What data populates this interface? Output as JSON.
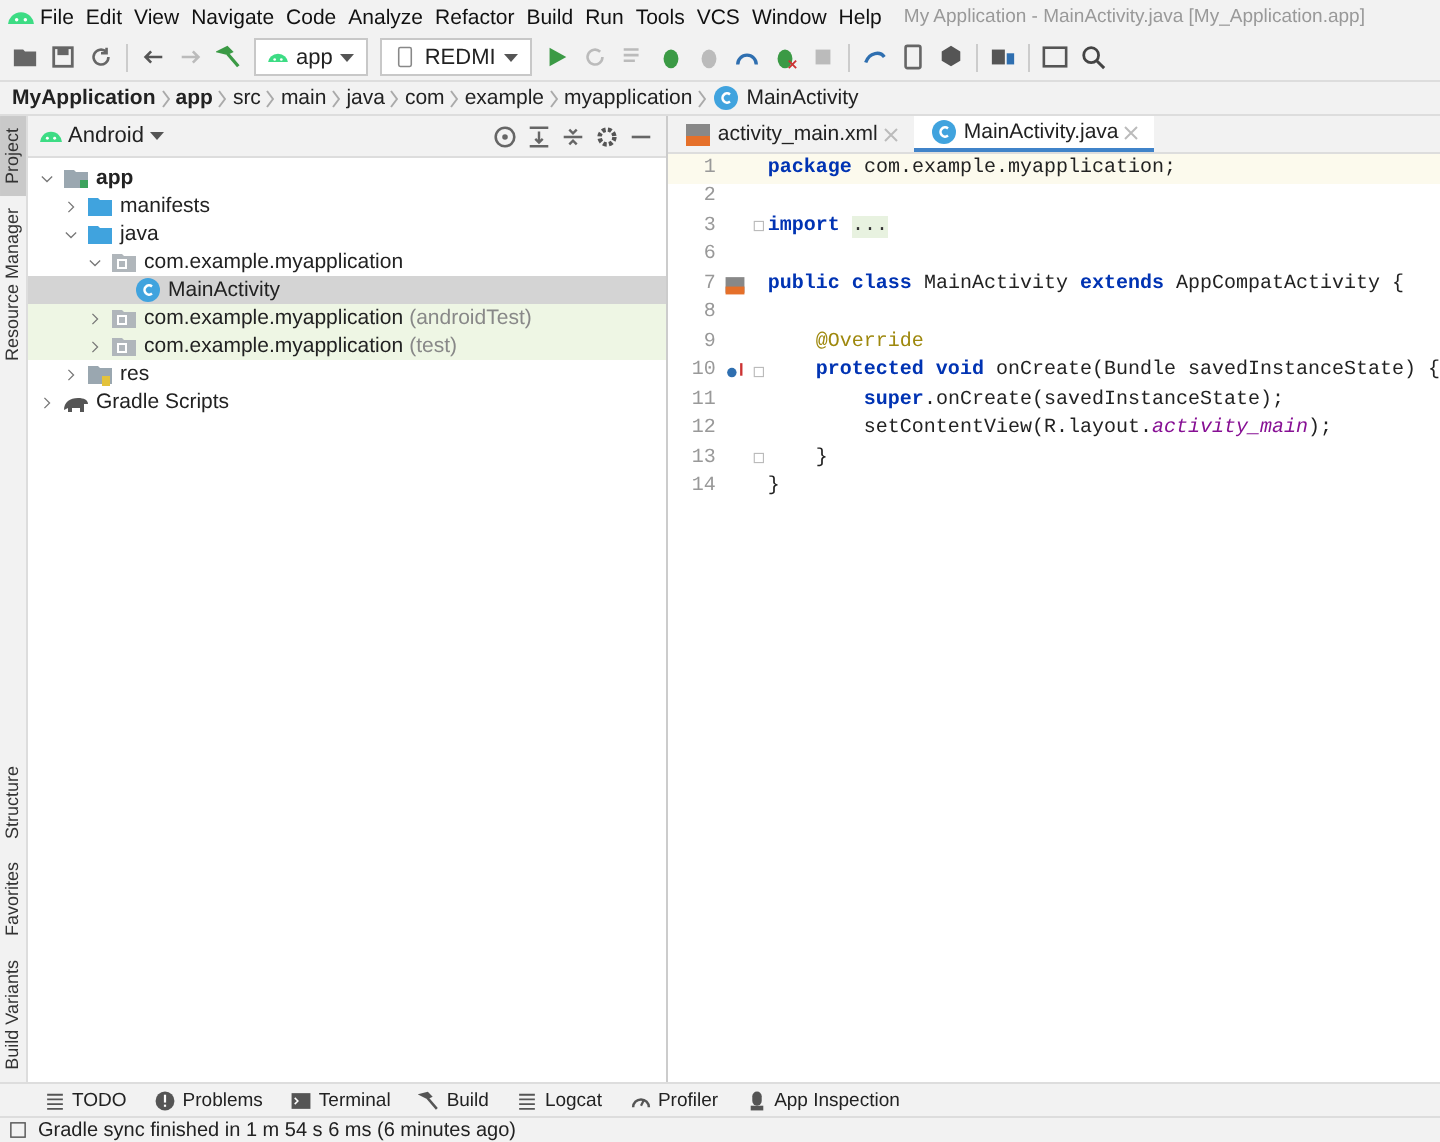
{
  "window": {
    "title": "My Application - MainActivity.java [My_Application.app]"
  },
  "menu": [
    "File",
    "Edit",
    "View",
    "Navigate",
    "Code",
    "Analyze",
    "Refactor",
    "Build",
    "Run",
    "Tools",
    "VCS",
    "Window",
    "Help"
  ],
  "toolbar": {
    "config": "app",
    "device": "REDMI"
  },
  "breadcrumb": [
    {
      "label": "MyApplication",
      "bold": true
    },
    {
      "label": "app",
      "bold": true
    },
    {
      "label": "src",
      "bold": false
    },
    {
      "label": "main",
      "bold": false
    },
    {
      "label": "java",
      "bold": false
    },
    {
      "label": "com",
      "bold": false
    },
    {
      "label": "example",
      "bold": false
    },
    {
      "label": "myapplication",
      "bold": false
    },
    {
      "label": "MainActivity",
      "bold": false,
      "kind": "class"
    }
  ],
  "side_tabs_top": [
    {
      "label": "Project",
      "selected": true
    },
    {
      "label": "Resource Manager",
      "selected": false
    }
  ],
  "side_tabs_bottom": [
    {
      "label": "Structure",
      "selected": false
    },
    {
      "label": "Favorites",
      "selected": false
    },
    {
      "label": "Build Variants",
      "selected": false
    }
  ],
  "project_panel": {
    "view": "Android",
    "tree": [
      {
        "label": "app",
        "kind": "module",
        "expanded": true,
        "selected": false,
        "highlighted": false,
        "children": [
          {
            "label": "manifests",
            "kind": "folder",
            "expanded": false,
            "selected": false,
            "highlighted": false
          },
          {
            "label": "java",
            "kind": "folder",
            "expanded": true,
            "selected": false,
            "highlighted": false,
            "children": [
              {
                "label": "com.example.myapplication",
                "kind": "package",
                "expanded": true,
                "selected": false,
                "highlighted": false,
                "children": [
                  {
                    "label": "MainActivity",
                    "kind": "class",
                    "selected": true,
                    "highlighted": false
                  }
                ]
              },
              {
                "label": "com.example.myapplication",
                "suffix": "(androidTest)",
                "kind": "package",
                "expanded": false,
                "selected": false,
                "highlighted": true
              },
              {
                "label": "com.example.myapplication",
                "suffix": "(test)",
                "kind": "package",
                "expanded": false,
                "selected": false,
                "highlighted": true
              }
            ]
          },
          {
            "label": "res",
            "kind": "res",
            "expanded": false,
            "selected": false,
            "highlighted": false
          }
        ]
      },
      {
        "label": "Gradle Scripts",
        "kind": "gradle",
        "expanded": false,
        "selected": false,
        "highlighted": false
      }
    ]
  },
  "editor": {
    "tabs": [
      {
        "label": "activity_main.xml",
        "kind": "xml",
        "selected": false
      },
      {
        "label": "MainActivity.java",
        "kind": "class",
        "selected": true
      }
    ],
    "lines": [
      {
        "number": "1",
        "current": true,
        "kind": "plain",
        "tokens": [
          {
            "text": "package",
            "kind": "keyword"
          },
          {
            "text": " com.example.myapplication;",
            "kind": "plain"
          }
        ]
      },
      {
        "number": "2",
        "current": false,
        "kind": "plain"
      },
      {
        "number": "3",
        "current": false,
        "kind": "plain",
        "fold": true,
        "tokens": [
          {
            "text": "import ",
            "kind": "keyword"
          },
          {
            "text": "...",
            "kind": "folded"
          }
        ]
      },
      {
        "number": "6",
        "current": false,
        "kind": "plain"
      },
      {
        "number": "7",
        "current": false,
        "kind": "layout_marker",
        "tokens": [
          {
            "text": "public class",
            "kind": "keyword"
          },
          {
            "text": " MainActivity ",
            "kind": "plain"
          },
          {
            "text": "extends",
            "kind": "keyword"
          },
          {
            "text": " AppCompatActivity {",
            "kind": "plain"
          }
        ]
      },
      {
        "number": "8",
        "current": false,
        "kind": "plain"
      },
      {
        "number": "9",
        "current": false,
        "kind": "plain",
        "tokens": [
          {
            "text": "    @Override",
            "kind": "annotation"
          }
        ]
      },
      {
        "number": "10",
        "current": false,
        "kind": "override_marker",
        "fold": true,
        "tokens": [
          {
            "text": "    protected void",
            "kind": "keyword"
          },
          {
            "text": " onCreate(Bundle savedInstanceState) {",
            "kind": "plain"
          }
        ]
      },
      {
        "number": "11",
        "current": false,
        "kind": "plain",
        "tokens": [
          {
            "text": "        super",
            "kind": "keyword"
          },
          {
            "text": ".onCreate(savedInstanceState);",
            "kind": "plain"
          }
        ]
      },
      {
        "number": "12",
        "current": false,
        "kind": "plain",
        "tokens": [
          {
            "text": "        setContentView(R.layout.",
            "kind": "plain"
          },
          {
            "text": "activity_main",
            "kind": "field"
          },
          {
            "text": ");",
            "kind": "plain"
          }
        ]
      },
      {
        "number": "13",
        "current": false,
        "kind": "plain",
        "fold": true,
        "tokens": [
          {
            "text": "    }",
            "kind": "plain"
          }
        ]
      },
      {
        "number": "14",
        "current": false,
        "kind": "plain",
        "tokens": [
          {
            "text": "}",
            "kind": "plain"
          }
        ]
      }
    ]
  },
  "tool_windows": [
    {
      "label": "TODO",
      "kind": "list"
    },
    {
      "label": "Problems",
      "kind": "problems"
    },
    {
      "label": "Terminal",
      "kind": "terminal"
    },
    {
      "label": "Build",
      "kind": "hammer"
    },
    {
      "label": "Logcat",
      "kind": "list"
    },
    {
      "label": "Profiler",
      "kind": "gauge"
    },
    {
      "label": "App Inspection",
      "kind": "inspect"
    }
  ],
  "status_bar": {
    "message": "Gradle sync finished in 1 m 54 s 6 ms (6 minutes ago)"
  }
}
